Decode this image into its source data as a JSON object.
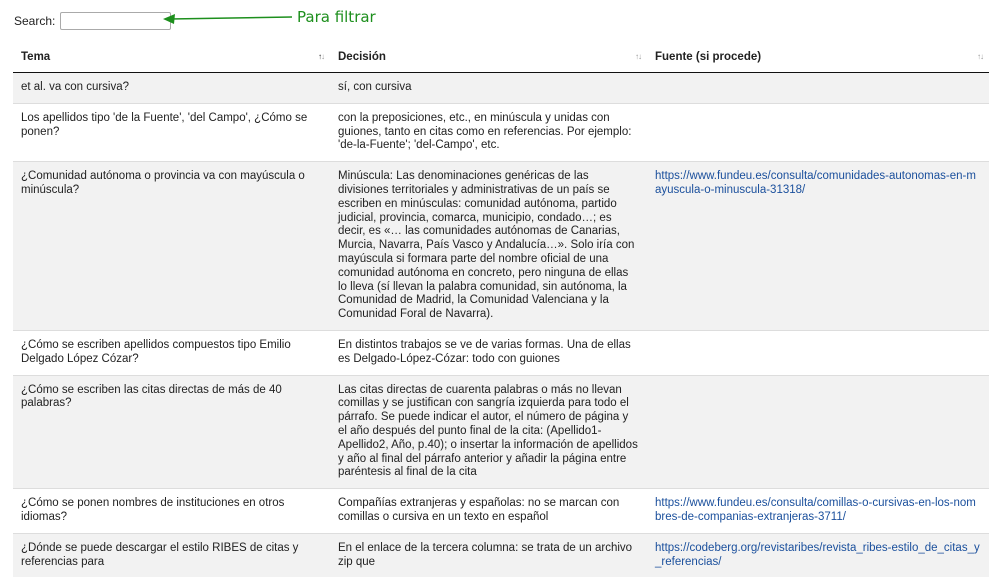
{
  "search": {
    "label": "Search:",
    "value": "",
    "placeholder": ""
  },
  "annotation": {
    "text": "Para filtrar",
    "color": "#1d8f1d"
  },
  "table": {
    "columns": [
      {
        "label": "Tema",
        "sort": "ascending"
      },
      {
        "label": "Decisión",
        "sort": "none"
      },
      {
        "label": "Fuente (si procede)",
        "sort": "none"
      }
    ],
    "rows": [
      {
        "tema": "et al. va con cursiva?",
        "decision": "sí, con cursiva",
        "fuente": ""
      },
      {
        "tema": "Los apellidos tipo 'de la Fuente', 'del Campo', ¿Cómo se ponen?",
        "decision": "con la preposiciones, etc., en minúscula y unidas con guiones, tanto en citas como en referencias. Por ejemplo: 'de-la-Fuente'; 'del-Campo', etc.",
        "fuente": ""
      },
      {
        "tema": "¿Comunidad autónoma o provincia va con mayúscula o minúscula?",
        "decision": "Minúscula: Las denominaciones genéricas de las divisiones territoriales y administrativas de un país se escriben en minúsculas: comunidad autónoma, partido judicial, provincia, comarca, municipio, condado…; es decir, es «… las comunidades autónomas de Canarias, Murcia, Navarra, País Vasco y Andalucía…». Solo iría con mayúscula si formara parte del nombre oficial de una comunidad autónoma en concreto, pero ninguna de ellas lo lleva (sí llevan la palabra comunidad, sin autónoma, la Comunidad de Madrid, la Comunidad Valenciana y la Comunidad Foral de Navarra).",
        "fuente": "https://www.fundeu.es/consulta/comunidades-autonomas-en-mayuscula-o-minuscula-31318/"
      },
      {
        "tema": "¿Cómo se escriben apellidos compuestos tipo Emilio Delgado López Cózar?",
        "decision": "En distintos trabajos se ve de varias formas. Una de ellas es Delgado-López-Cózar: todo con guiones",
        "fuente": ""
      },
      {
        "tema": "¿Cómo se escriben las citas directas de más de 40 palabras?",
        "decision": "Las citas directas de cuarenta palabras o más no llevan comillas y se justifican con sangría izquierda para todo el párrafo. Se puede indicar el autor, el número de página y el año después del punto final de la cita: (Apellido1-Apellido2, Año, p.40); o insertar la información de apellidos y año al final del párrafo anterior y añadir la página entre paréntesis al final de la cita",
        "fuente": ""
      },
      {
        "tema": "¿Cómo se ponen nombres de instituciones en otros idiomas?",
        "decision": "Compañías extranjeras y españolas: no se marcan con comillas o cursiva en un texto en español",
        "fuente": "https://www.fundeu.es/consulta/comillas-o-cursivas-en-los-nombres-de-companias-extranjeras-3711/"
      },
      {
        "tema": "¿Dónde se puede descargar el estilo RIBES de citas y referencias para",
        "decision": "En el enlace de la tercera columna: se trata de un archivo zip que",
        "fuente": "https://codeberg.org/revistaribes/revista_ribes-estilo_de_citas_y_referencias/"
      }
    ]
  }
}
